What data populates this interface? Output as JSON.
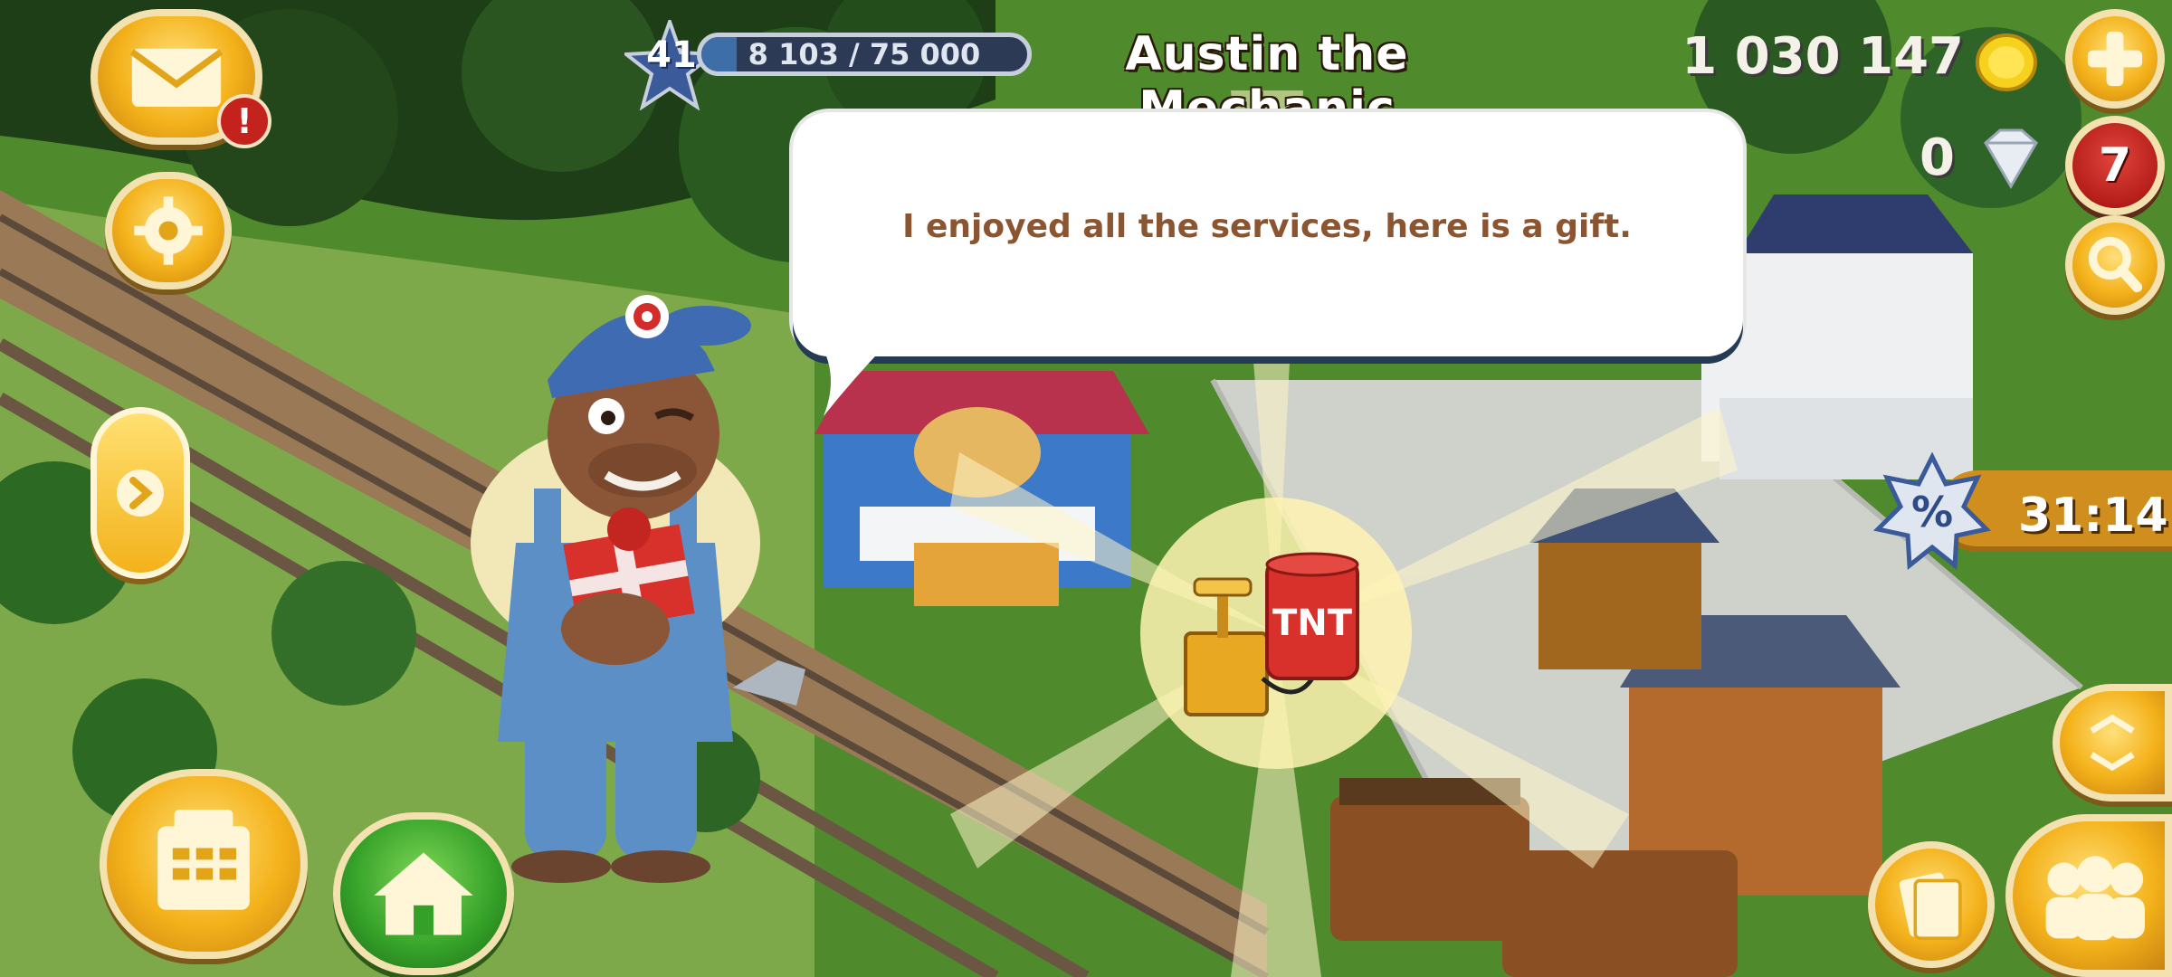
{
  "hud": {
    "level": "41",
    "xp": {
      "text": "8 103 / 75 000",
      "progress": 0.108
    },
    "coins": "1 030 147",
    "diamonds": "0",
    "diamond_purchase_count": "7",
    "boost_timer": "31:14"
  },
  "dialog": {
    "npc_name": "Austin the Mechanic",
    "message": "I enjoyed all the services, here is a gift.",
    "gift": {
      "label": "TNT",
      "icon": "tnt-detonator-icon"
    }
  },
  "buttons": {
    "mail": "envelope-icon",
    "mail_alert": "!",
    "settings": "gear-icon",
    "expand_npc": "chevron-right-icon",
    "shop": "cash-register-icon",
    "home": "house-icon",
    "add_coins": "plus-icon",
    "search": "magnifier-icon",
    "fullscreen": "expand-arrows-icon",
    "collection": "cards-icon",
    "friends": "people-icon"
  },
  "colors": {
    "gold": "#f4b21b",
    "red": "#c4231d",
    "dialog_text": "#8a5530",
    "xp_fill": "#3e6ea8"
  }
}
